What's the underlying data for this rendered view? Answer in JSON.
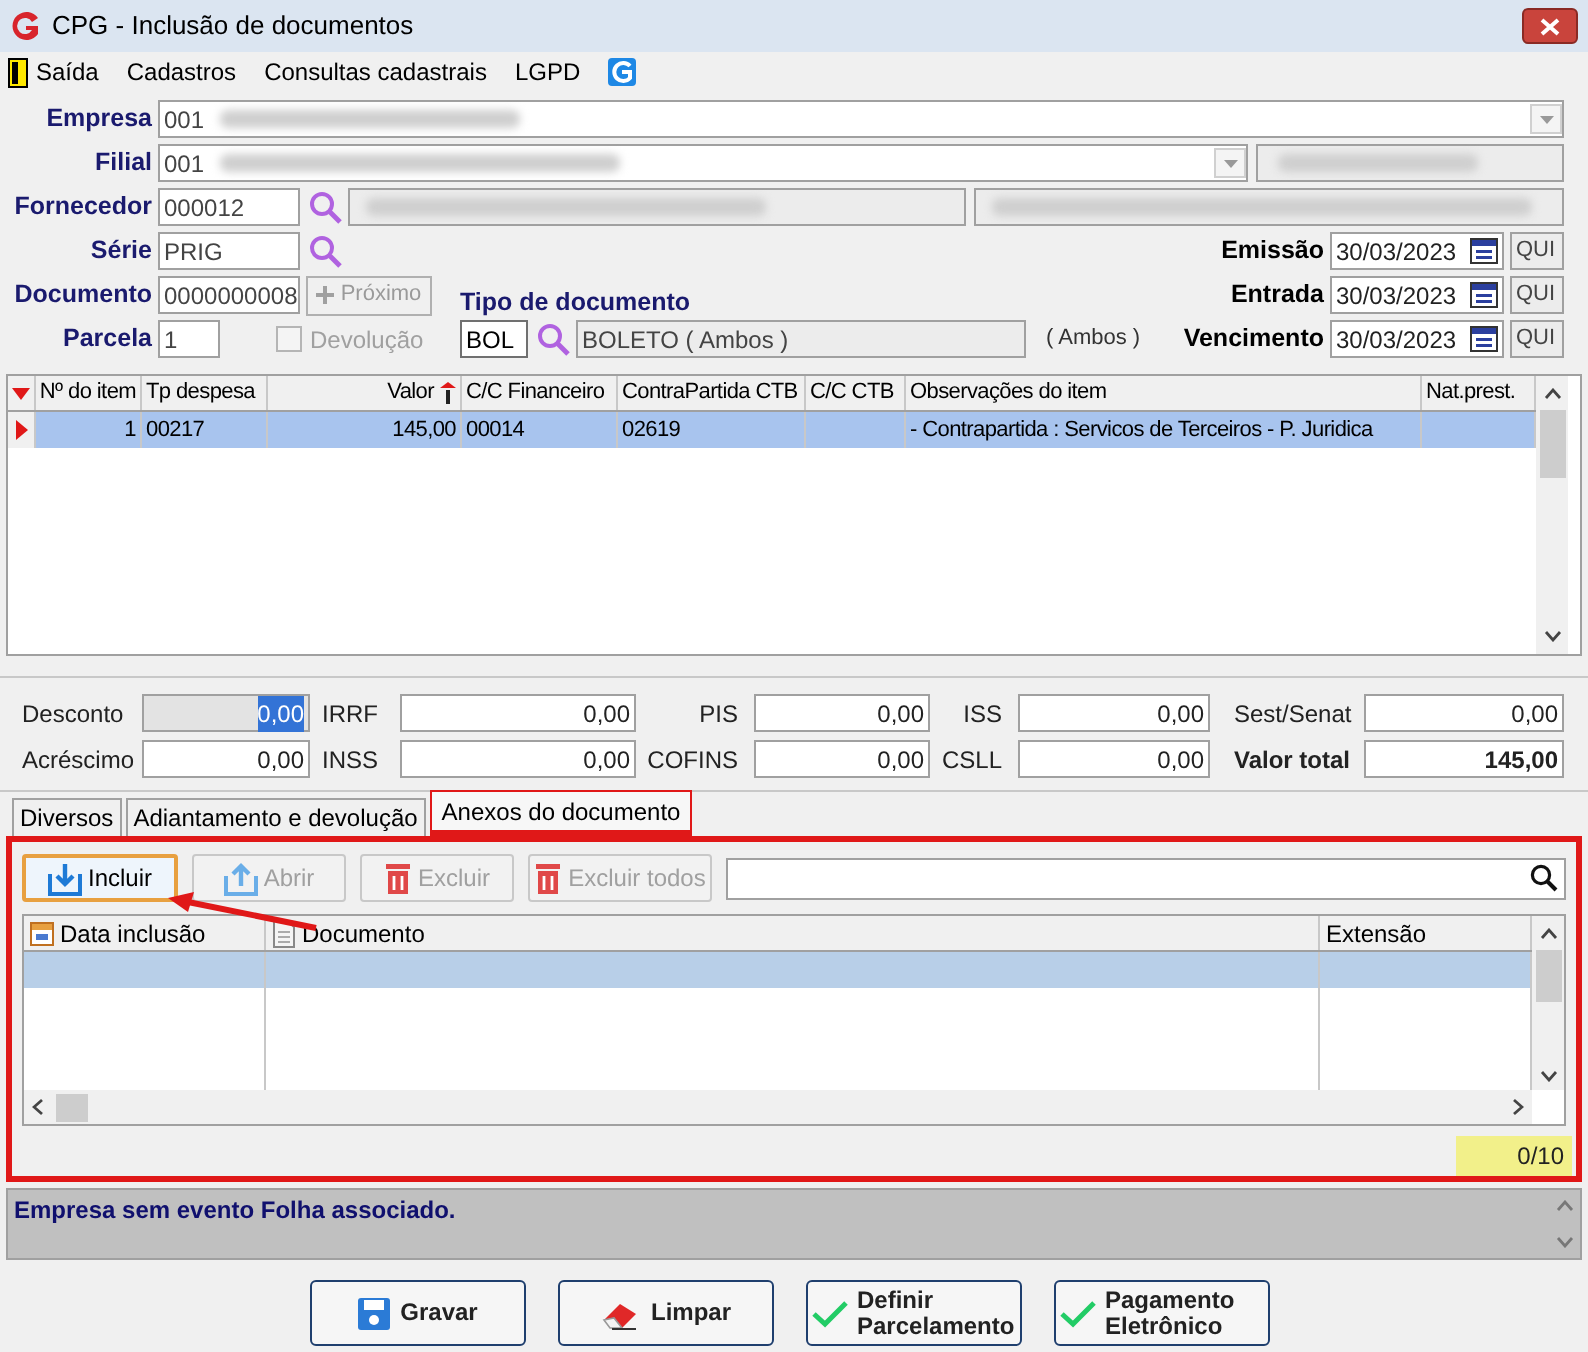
{
  "window": {
    "title": "CPG - Inclusão de documentos"
  },
  "menu": [
    "Saída",
    "Cadastros",
    "Consultas cadastrais",
    "LGPD"
  ],
  "header_fields": {
    "empresa": {
      "label": "Empresa",
      "value": "001"
    },
    "filial": {
      "label": "Filial",
      "value": "001"
    },
    "fornecedor": {
      "label": "Fornecedor",
      "value": "000012"
    },
    "serie": {
      "label": "Série",
      "value": "PRIG"
    },
    "documento": {
      "label": "Documento",
      "value": "0000000008"
    },
    "proximo_button": {
      "label": "Próximo",
      "disabled": true
    },
    "parcela": {
      "label": "Parcela",
      "value": "1"
    },
    "devolucao": {
      "label": "Devolução",
      "checked": false,
      "disabled": true
    },
    "tipo_documento": {
      "label": "Tipo de documento",
      "code": "BOL",
      "description": "BOLETO ( Ambos )",
      "note": "( Ambos )"
    }
  },
  "dates": [
    {
      "label": "Emissão",
      "value": "30/03/2023",
      "weekday": "QUI"
    },
    {
      "label": "Entrada",
      "value": "30/03/2023",
      "weekday": "QUI"
    },
    {
      "label": "Vencimento",
      "value": "30/03/2023",
      "weekday": "QUI"
    }
  ],
  "items_table": {
    "columns": [
      {
        "label": "Nº do item",
        "sorted": false
      },
      {
        "label": "Tp despesa",
        "sorted": false
      },
      {
        "label": "Valor",
        "sorted": true
      },
      {
        "label": "C/C Financeiro",
        "sorted": false
      },
      {
        "label": "ContraPartida CTB",
        "sorted": false
      },
      {
        "label": "C/C CTB",
        "sorted": false
      },
      {
        "label": "Observações do item",
        "sorted": false
      },
      {
        "label": "Nat.prest.",
        "sorted": false
      }
    ],
    "rows": [
      {
        "selected": true,
        "cells": [
          "1",
          "00217",
          "145,00",
          "00014",
          "02619",
          null,
          "- Contrapartida : Servicos de Terceiros - P. Juridica",
          null
        ]
      }
    ]
  },
  "totals": [
    {
      "label": "Desconto",
      "value": "0,00",
      "kind": "field",
      "disabled": true,
      "text_selected": true
    },
    {
      "label": "IRRF",
      "value": "0,00",
      "kind": "field",
      "disabled": false,
      "text_selected": false
    },
    {
      "label": "PIS",
      "value": "0,00",
      "kind": "field",
      "disabled": false,
      "text_selected": false
    },
    {
      "label": "ISS",
      "value": "0,00",
      "kind": "field",
      "disabled": false,
      "text_selected": false
    },
    {
      "label": "Sest/Senat",
      "value": "0,00",
      "kind": "field",
      "disabled": false,
      "text_selected": false
    },
    {
      "label": "Acréscimo",
      "value": "0,00",
      "kind": "field",
      "disabled": false,
      "text_selected": false
    },
    {
      "label": "INSS",
      "value": "0,00",
      "kind": "field",
      "disabled": false,
      "text_selected": false
    },
    {
      "label": "COFINS",
      "value": "0,00",
      "kind": "field",
      "disabled": false,
      "text_selected": false
    },
    {
      "label": "CSLL",
      "value": "0,00",
      "kind": "field",
      "disabled": false,
      "text_selected": false
    },
    {
      "label": "Valor total",
      "value": "145,00",
      "kind": "total",
      "disabled": false,
      "text_selected": false
    }
  ],
  "tabs": [
    {
      "label": "Diversos",
      "selected": false
    },
    {
      "label": "Adiantamento e devolução",
      "selected": false
    },
    {
      "label": "Anexos do documento",
      "selected": true
    }
  ],
  "attachments": {
    "toolbar": [
      {
        "label": "Incluir",
        "kind": "add",
        "disabled": false,
        "focused": true
      },
      {
        "label": "Abrir",
        "kind": "open",
        "disabled": true,
        "focused": false
      },
      {
        "label": "Excluir",
        "kind": "delete",
        "disabled": true,
        "focused": false
      },
      {
        "label": "Excluir todos",
        "kind": "delete",
        "disabled": true,
        "focused": false
      }
    ],
    "columns": [
      {
        "label": "Data inclusão",
        "kind": "date"
      },
      {
        "label": "Documento",
        "kind": "document"
      },
      {
        "label": "Extensão",
        "kind": "plain"
      }
    ],
    "rows": [
      {
        "selected": true
      }
    ],
    "counter": "0/10"
  },
  "message": "Empresa sem evento Folha associado.",
  "actions": [
    {
      "label": "Gravar",
      "kind": "save"
    },
    {
      "label": "Limpar",
      "kind": "clear"
    },
    {
      "label": "Definir Parcelamento",
      "kind": "confirm"
    },
    {
      "label": "Pagamento Eletrônico",
      "kind": "confirm"
    }
  ]
}
